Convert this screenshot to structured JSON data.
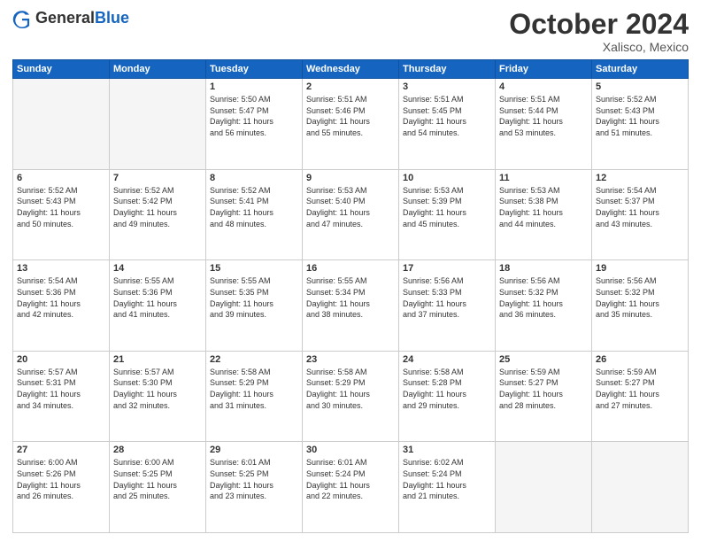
{
  "header": {
    "logo_general": "General",
    "logo_blue": "Blue",
    "month_title": "October 2024",
    "location": "Xalisco, Mexico"
  },
  "weekdays": [
    "Sunday",
    "Monday",
    "Tuesday",
    "Wednesday",
    "Thursday",
    "Friday",
    "Saturday"
  ],
  "weeks": [
    [
      {
        "day": "",
        "info": ""
      },
      {
        "day": "",
        "info": ""
      },
      {
        "day": "1",
        "info": "Sunrise: 5:50 AM\nSunset: 5:47 PM\nDaylight: 11 hours\nand 56 minutes."
      },
      {
        "day": "2",
        "info": "Sunrise: 5:51 AM\nSunset: 5:46 PM\nDaylight: 11 hours\nand 55 minutes."
      },
      {
        "day": "3",
        "info": "Sunrise: 5:51 AM\nSunset: 5:45 PM\nDaylight: 11 hours\nand 54 minutes."
      },
      {
        "day": "4",
        "info": "Sunrise: 5:51 AM\nSunset: 5:44 PM\nDaylight: 11 hours\nand 53 minutes."
      },
      {
        "day": "5",
        "info": "Sunrise: 5:52 AM\nSunset: 5:43 PM\nDaylight: 11 hours\nand 51 minutes."
      }
    ],
    [
      {
        "day": "6",
        "info": "Sunrise: 5:52 AM\nSunset: 5:43 PM\nDaylight: 11 hours\nand 50 minutes."
      },
      {
        "day": "7",
        "info": "Sunrise: 5:52 AM\nSunset: 5:42 PM\nDaylight: 11 hours\nand 49 minutes."
      },
      {
        "day": "8",
        "info": "Sunrise: 5:52 AM\nSunset: 5:41 PM\nDaylight: 11 hours\nand 48 minutes."
      },
      {
        "day": "9",
        "info": "Sunrise: 5:53 AM\nSunset: 5:40 PM\nDaylight: 11 hours\nand 47 minutes."
      },
      {
        "day": "10",
        "info": "Sunrise: 5:53 AM\nSunset: 5:39 PM\nDaylight: 11 hours\nand 45 minutes."
      },
      {
        "day": "11",
        "info": "Sunrise: 5:53 AM\nSunset: 5:38 PM\nDaylight: 11 hours\nand 44 minutes."
      },
      {
        "day": "12",
        "info": "Sunrise: 5:54 AM\nSunset: 5:37 PM\nDaylight: 11 hours\nand 43 minutes."
      }
    ],
    [
      {
        "day": "13",
        "info": "Sunrise: 5:54 AM\nSunset: 5:36 PM\nDaylight: 11 hours\nand 42 minutes."
      },
      {
        "day": "14",
        "info": "Sunrise: 5:55 AM\nSunset: 5:36 PM\nDaylight: 11 hours\nand 41 minutes."
      },
      {
        "day": "15",
        "info": "Sunrise: 5:55 AM\nSunset: 5:35 PM\nDaylight: 11 hours\nand 39 minutes."
      },
      {
        "day": "16",
        "info": "Sunrise: 5:55 AM\nSunset: 5:34 PM\nDaylight: 11 hours\nand 38 minutes."
      },
      {
        "day": "17",
        "info": "Sunrise: 5:56 AM\nSunset: 5:33 PM\nDaylight: 11 hours\nand 37 minutes."
      },
      {
        "day": "18",
        "info": "Sunrise: 5:56 AM\nSunset: 5:32 PM\nDaylight: 11 hours\nand 36 minutes."
      },
      {
        "day": "19",
        "info": "Sunrise: 5:56 AM\nSunset: 5:32 PM\nDaylight: 11 hours\nand 35 minutes."
      }
    ],
    [
      {
        "day": "20",
        "info": "Sunrise: 5:57 AM\nSunset: 5:31 PM\nDaylight: 11 hours\nand 34 minutes."
      },
      {
        "day": "21",
        "info": "Sunrise: 5:57 AM\nSunset: 5:30 PM\nDaylight: 11 hours\nand 32 minutes."
      },
      {
        "day": "22",
        "info": "Sunrise: 5:58 AM\nSunset: 5:29 PM\nDaylight: 11 hours\nand 31 minutes."
      },
      {
        "day": "23",
        "info": "Sunrise: 5:58 AM\nSunset: 5:29 PM\nDaylight: 11 hours\nand 30 minutes."
      },
      {
        "day": "24",
        "info": "Sunrise: 5:58 AM\nSunset: 5:28 PM\nDaylight: 11 hours\nand 29 minutes."
      },
      {
        "day": "25",
        "info": "Sunrise: 5:59 AM\nSunset: 5:27 PM\nDaylight: 11 hours\nand 28 minutes."
      },
      {
        "day": "26",
        "info": "Sunrise: 5:59 AM\nSunset: 5:27 PM\nDaylight: 11 hours\nand 27 minutes."
      }
    ],
    [
      {
        "day": "27",
        "info": "Sunrise: 6:00 AM\nSunset: 5:26 PM\nDaylight: 11 hours\nand 26 minutes."
      },
      {
        "day": "28",
        "info": "Sunrise: 6:00 AM\nSunset: 5:25 PM\nDaylight: 11 hours\nand 25 minutes."
      },
      {
        "day": "29",
        "info": "Sunrise: 6:01 AM\nSunset: 5:25 PM\nDaylight: 11 hours\nand 23 minutes."
      },
      {
        "day": "30",
        "info": "Sunrise: 6:01 AM\nSunset: 5:24 PM\nDaylight: 11 hours\nand 22 minutes."
      },
      {
        "day": "31",
        "info": "Sunrise: 6:02 AM\nSunset: 5:24 PM\nDaylight: 11 hours\nand 21 minutes."
      },
      {
        "day": "",
        "info": ""
      },
      {
        "day": "",
        "info": ""
      }
    ]
  ]
}
